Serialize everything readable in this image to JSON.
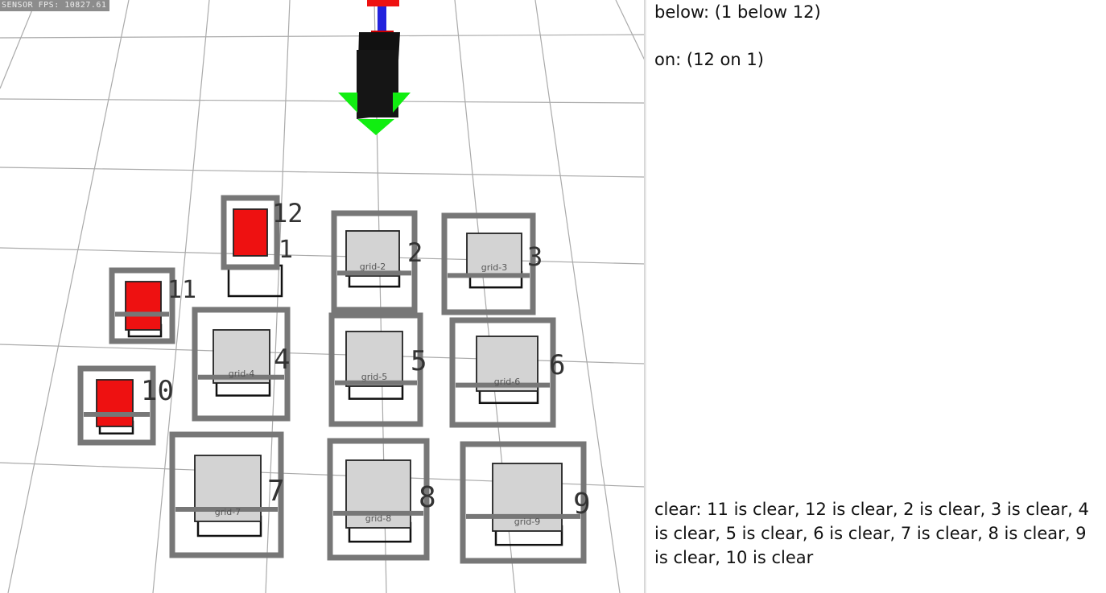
{
  "viewport": {
    "sensor_fps": "SENSOR FPS: 10827.61",
    "block_labels": [
      "1",
      "2",
      "3",
      "4",
      "5",
      "6",
      "7",
      "8",
      "9",
      "10",
      "11",
      "12"
    ],
    "grid_labels": [
      "grid-2",
      "grid-3",
      "grid-4",
      "grid-5",
      "grid-6",
      "grid-7",
      "grid-8",
      "grid-9"
    ],
    "colors": {
      "floor_line": "#aaaaaa",
      "frame": "#777777",
      "block_gray": "#d3d3d3",
      "block_red": "#ee1111",
      "gripper_green": "#11ee11",
      "arm_blue": "#2222dd"
    }
  },
  "predicates": {
    "below": "below: (1 below 12)",
    "on": "on: (12 on 1)",
    "clear": "clear: 11 is clear, 12 is clear, 2 is clear, 3 is clear, 4 is clear, 5 is clear, 6 is clear, 7 is clear, 8 is clear, 9 is clear, 10 is clear"
  }
}
